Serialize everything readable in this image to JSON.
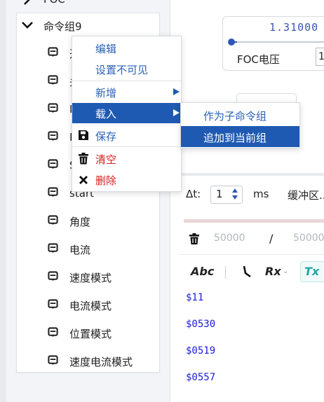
{
  "header": {
    "top_partial_label": "FOC"
  },
  "tree": {
    "group_label": "命令组9",
    "items": [
      {
        "label": "开"
      },
      {
        "label": "关"
      },
      {
        "label": "I"
      },
      {
        "label": "I"
      },
      {
        "label": "S"
      },
      {
        "label": "start"
      },
      {
        "label": "角度"
      },
      {
        "label": "电流"
      },
      {
        "label": "速度模式"
      },
      {
        "label": "电流模式"
      },
      {
        "label": "位置模式"
      },
      {
        "label": "速度电流模式"
      }
    ]
  },
  "context_menu": {
    "items": [
      {
        "label": "编辑",
        "color": "#2b62b6"
      },
      {
        "label": "设置不可见",
        "color": "#2b62b6"
      },
      {
        "label": "新增",
        "color": "#2b62b6"
      },
      {
        "label": "载入",
        "color": "#ffffff"
      },
      {
        "label": "保存",
        "color": "#2b62b6"
      },
      {
        "label": "清空",
        "color": "#d81e1e"
      },
      {
        "label": "删除",
        "color": "#d81e1e"
      }
    ],
    "submenu": [
      {
        "label": "作为子命令组"
      },
      {
        "label": "追加到当前组"
      }
    ]
  },
  "control": {
    "value": "1.31000",
    "label": "FOC电压",
    "input_value": "1"
  },
  "timing": {
    "dt_label": "Δt:",
    "dt_value": "1",
    "unit": "ms",
    "buffer_label": "缓冲区..."
  },
  "buffer": {
    "count": "50000",
    "separator": "/",
    "total": "50000"
  },
  "toolbar": {
    "abc": "Abc",
    "rx": "Rx",
    "tx": "Tx"
  },
  "output_lines": [
    "$11",
    "$0530",
    "$0519",
    "$0557"
  ],
  "colors": {
    "accent": "#1f5ab2",
    "danger": "#d81e1e",
    "hex_text": "#1b1bd6",
    "tx_accent": "#1ea7a7"
  }
}
